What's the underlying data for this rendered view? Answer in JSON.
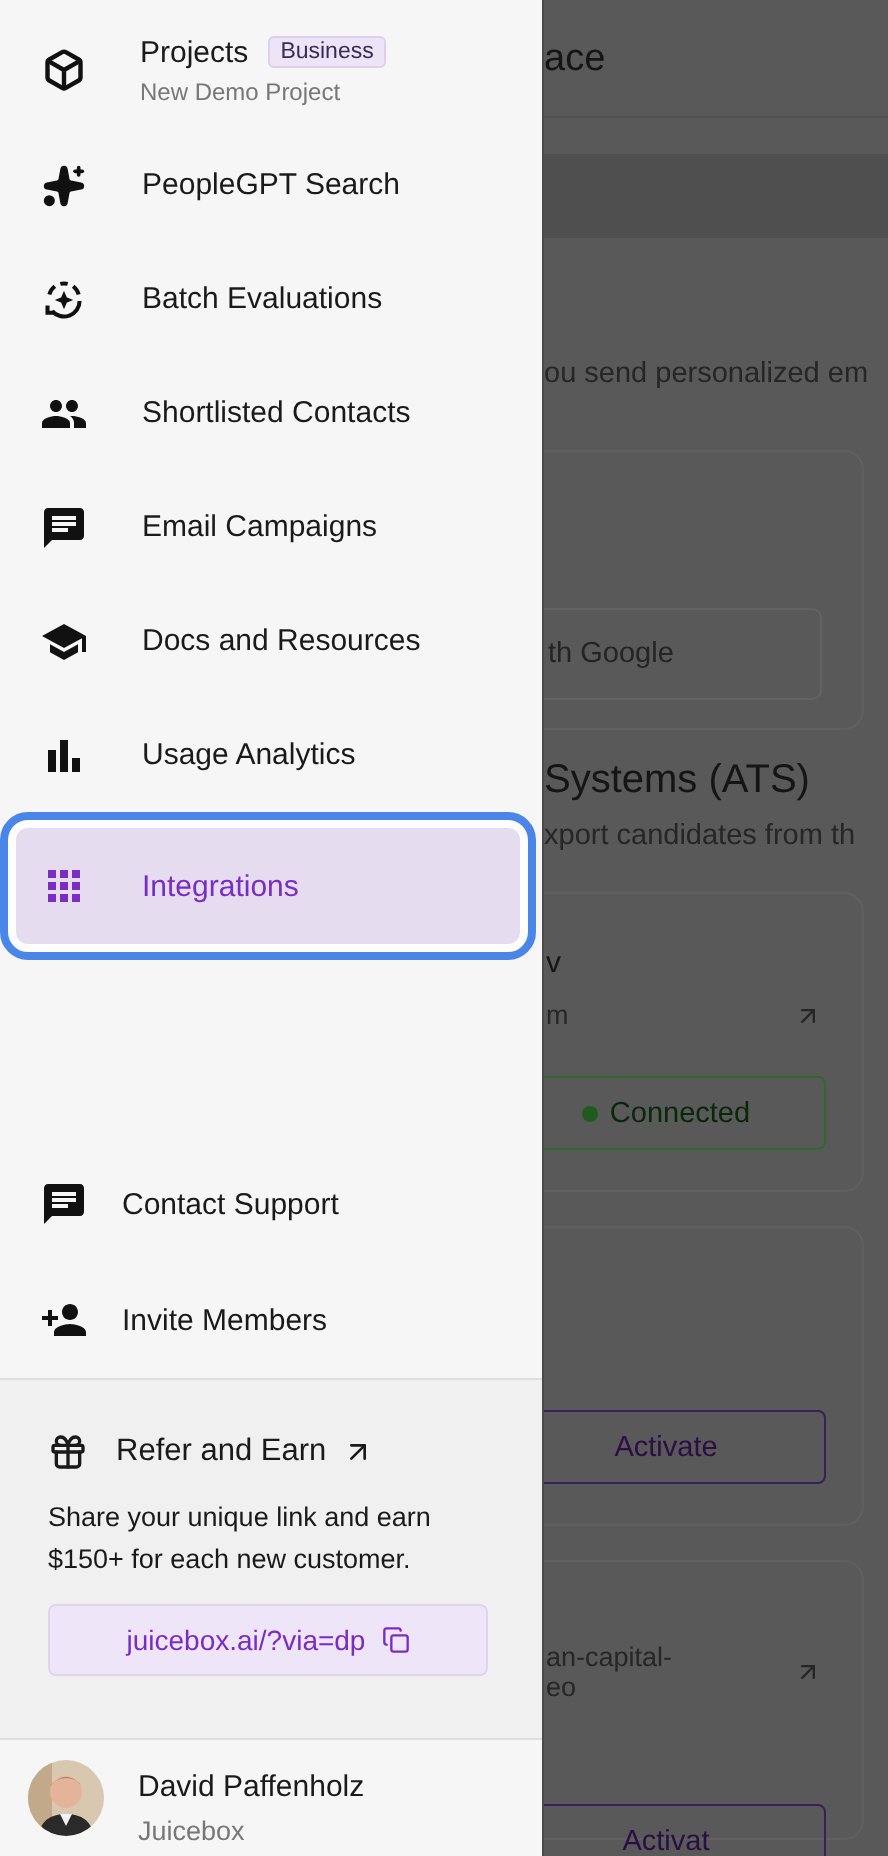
{
  "sidebar": {
    "project": {
      "label": "Projects",
      "badge": "Business",
      "subtitle": "New Demo Project"
    },
    "nav_items": [
      {
        "label": "PeopleGPT Search",
        "selected": false
      },
      {
        "label": "Batch Evaluations",
        "selected": false
      },
      {
        "label": "Shortlisted Contacts",
        "selected": false
      },
      {
        "label": "Email Campaigns",
        "selected": false
      },
      {
        "label": "Docs and Resources",
        "selected": false
      },
      {
        "label": "Usage Analytics",
        "selected": false
      },
      {
        "label": "Integrations",
        "selected": true
      }
    ],
    "footer_items": [
      {
        "label": "Contact Support"
      },
      {
        "label": "Invite Members"
      }
    ],
    "referral": {
      "title": "Refer and Earn",
      "description": "Share your unique link and earn $150+ for each new customer.",
      "link": "juicebox.ai/?via=dp"
    },
    "user": {
      "name": "David Paffenholz",
      "company": "Juicebox"
    }
  },
  "background_page": {
    "title": "ace",
    "intro": "ou send personalized em",
    "google_button": "th Google",
    "section_title": "Systems (ATS)",
    "section_text": "xport candidates from th",
    "cards": [
      {
        "title": "v",
        "link": "m",
        "button": "Connected",
        "kind": "connected"
      },
      {
        "button": "Activate",
        "kind": "activate"
      },
      {
        "link": "an-capital-\neo",
        "button": "Activat",
        "kind": "activate"
      }
    ]
  }
}
